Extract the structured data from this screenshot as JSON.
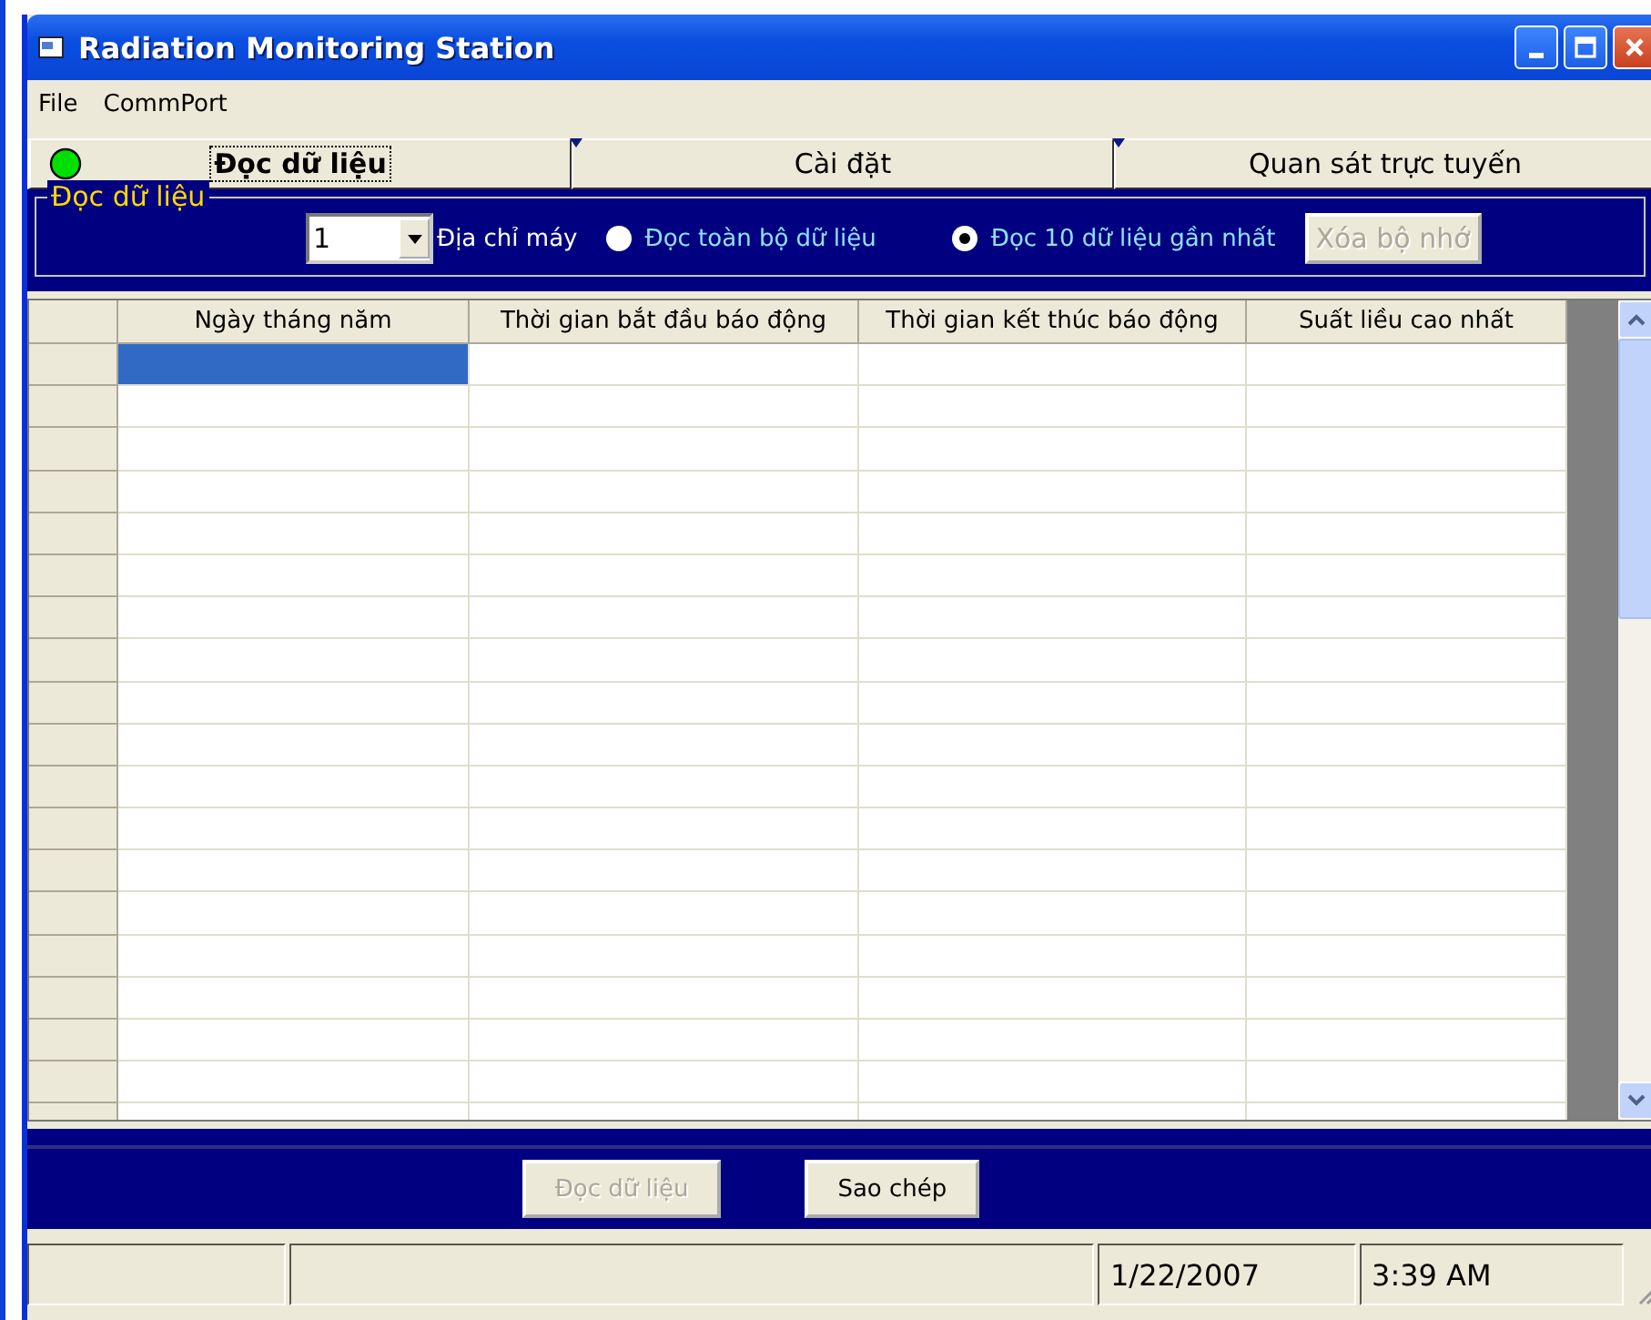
{
  "window": {
    "title": "Radiation Monitoring Station"
  },
  "menu": [
    {
      "label": "File"
    },
    {
      "label": "CommPort"
    }
  ],
  "tabs": [
    {
      "label": "Đọc dữ liệu",
      "selected": true
    },
    {
      "label": "Cài đặt",
      "selected": false
    },
    {
      "label": "Quan sát trực tuyến",
      "selected": false
    }
  ],
  "read_panel": {
    "title": "Đọc dữ liệu",
    "address": {
      "value": "1",
      "label": "Địa chỉ máy"
    },
    "options": [
      {
        "label": "Đọc toàn bộ dữ liệu",
        "selected": false
      },
      {
        "label": "Đọc 10 dữ liệu gần nhất",
        "selected": true
      }
    ],
    "clear_button": {
      "label": "Xóa bộ nhớ",
      "disabled": true
    }
  },
  "table": {
    "columns": [
      "Ngày tháng năm",
      "Thời gian bắt đầu báo động",
      "Thời gian kết thúc báo động",
      "Suất liều cao nhất"
    ],
    "rows": [
      {
        "selected": true
      },
      {
        "selected": false
      },
      {
        "selected": false
      },
      {
        "selected": false
      },
      {
        "selected": false
      },
      {
        "selected": false
      },
      {
        "selected": false
      },
      {
        "selected": false
      },
      {
        "selected": false
      },
      {
        "selected": false
      },
      {
        "selected": false
      },
      {
        "selected": false
      },
      {
        "selected": false
      },
      {
        "selected": false
      },
      {
        "selected": false
      },
      {
        "selected": false
      },
      {
        "selected": false
      },
      {
        "selected": false
      },
      {
        "selected": false
      }
    ]
  },
  "buttons": [
    {
      "label": "Đọc dữ liệu",
      "disabled": true
    },
    {
      "label": "Sao chép",
      "disabled": false
    }
  ],
  "status_bar": [
    {
      "kind": "blank"
    },
    {
      "kind": "blank"
    },
    {
      "kind": "text",
      "text": "1/22/2007"
    },
    {
      "kind": "text",
      "text": "3:39 AM"
    }
  ]
}
